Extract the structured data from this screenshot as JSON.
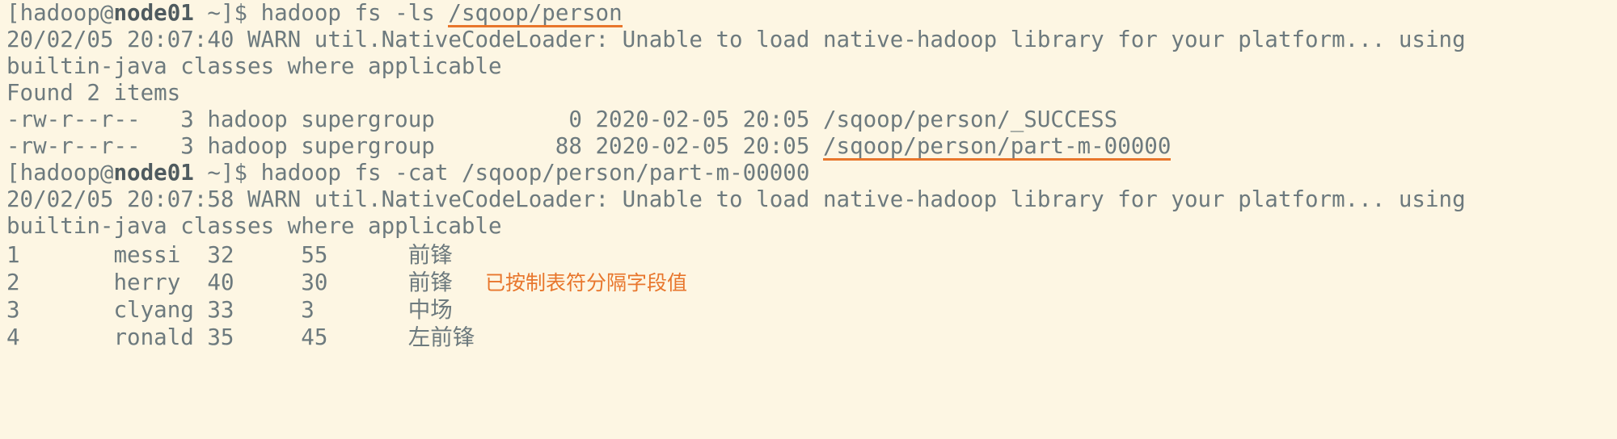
{
  "terminal": {
    "background_color": "#fdf6e3",
    "text_color": "#6d7a7e",
    "highlight_color": "#e8762c",
    "prompt_user": "hadoop",
    "prompt_at": "@",
    "prompt_host": "node01",
    "prompt_cwd": "~",
    "prompt_bracket_open": "[",
    "prompt_bracket_close": "]$ ",
    "lines": {
      "cmd1": {
        "prefix_open": "[",
        "user": "hadoop",
        "at": "@",
        "host": "node01",
        "space": " ",
        "cwd": "~",
        "close": "]$ ",
        "command": "hadoop fs -ls ",
        "highlighted_arg": "/sqoop/person"
      },
      "warn1": "20/02/05 20:07:40 WARN util.NativeCodeLoader: Unable to load native-hadoop library for your platform... using",
      "warn1_wrap": "builtin-java classes where applicable",
      "found": "Found 2 items",
      "file1": "-rw-r--r--   3 hadoop supergroup          0 2020-02-05 20:05 /sqoop/person/_SUCCESS",
      "file2_prefix": "-rw-r--r--   3 hadoop supergroup         88 2020-02-05 20:05 ",
      "file2_highlighted": "/sqoop/person/part-m-00000",
      "cmd2": {
        "prefix_open": "[",
        "user": "hadoop",
        "at": "@",
        "host": "node01",
        "space": " ",
        "cwd": "~",
        "close": "]$ ",
        "command": "hadoop fs -cat /sqoop/person/part-m-00000"
      },
      "warn2": "20/02/05 20:07:58 WARN util.NativeCodeLoader: Unable to load native-hadoop library for your platform... using",
      "warn2_wrap": "builtin-java classes where applicable"
    },
    "table_rows": [
      {
        "id": "1",
        "name": "messi",
        "age": "32",
        "num": "55",
        "position": "前锋"
      },
      {
        "id": "2",
        "name": "herry",
        "age": "40",
        "num": "30",
        "position": "前锋"
      },
      {
        "id": "3",
        "name": "clyang",
        "age": "33",
        "num": "3",
        "position": "中场"
      },
      {
        "id": "4",
        "name": "ronald",
        "age": "35",
        "num": "45",
        "position": "左前锋"
      }
    ],
    "annotation": "已按制表符分隔字段值"
  }
}
